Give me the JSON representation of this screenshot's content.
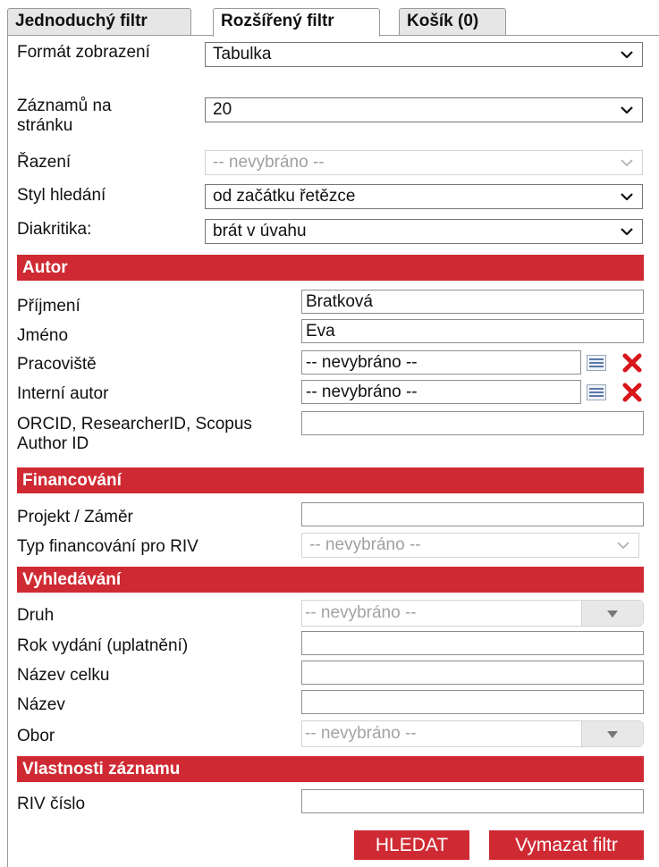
{
  "tabs": [
    {
      "label": "Jednoduchý filtr"
    },
    {
      "label": "Rozšířený filtr"
    },
    {
      "label": "Košík (0)"
    }
  ],
  "settings": {
    "format": {
      "label": "Formát zobrazení",
      "value": "Tabulka"
    },
    "per_page": {
      "label": "Záznamů na stránku",
      "value": "20"
    },
    "sort": {
      "label": "Řazení",
      "value": "-- nevybráno --"
    },
    "search_style": {
      "label": "Styl hledání",
      "value": "od začátku řetězce"
    },
    "diacritics": {
      "label": "Diakritika:",
      "value": "brát v úvahu"
    }
  },
  "sections": {
    "author": "Autor",
    "funding": "Financování",
    "search": "Vyhledávání",
    "record": "Vlastnosti záznamu"
  },
  "author": {
    "surname": {
      "label": "Příjmení",
      "value": "Bratková"
    },
    "firstname": {
      "label": "Jméno",
      "value": "Eva"
    },
    "workplace": {
      "label": "Pracoviště",
      "value": "-- nevybráno --"
    },
    "internal": {
      "label": "Interní autor",
      "value": "-- nevybráno --"
    },
    "orcid": {
      "label": "ORCID, ResearcherID, Scopus Author ID",
      "value": ""
    }
  },
  "funding": {
    "project": {
      "label": "Projekt / Záměr",
      "value": ""
    },
    "riv_type": {
      "label": "Typ financování pro RIV",
      "value": "-- nevybráno --"
    }
  },
  "search": {
    "kind": {
      "label": "Druh",
      "value": "-- nevybráno --"
    },
    "year": {
      "label": "Rok vydání (uplatnění)",
      "value": ""
    },
    "whole_title": {
      "label": "Název celku",
      "value": ""
    },
    "title": {
      "label": "Název",
      "value": ""
    },
    "field": {
      "label": "Obor",
      "value": "-- nevybráno --"
    }
  },
  "record": {
    "riv": {
      "label": "RIV číslo",
      "value": ""
    }
  },
  "buttons": {
    "search": "HLEDAT",
    "clear": "Vymazat filtr"
  },
  "colors": {
    "accent": "#cf2a33"
  }
}
